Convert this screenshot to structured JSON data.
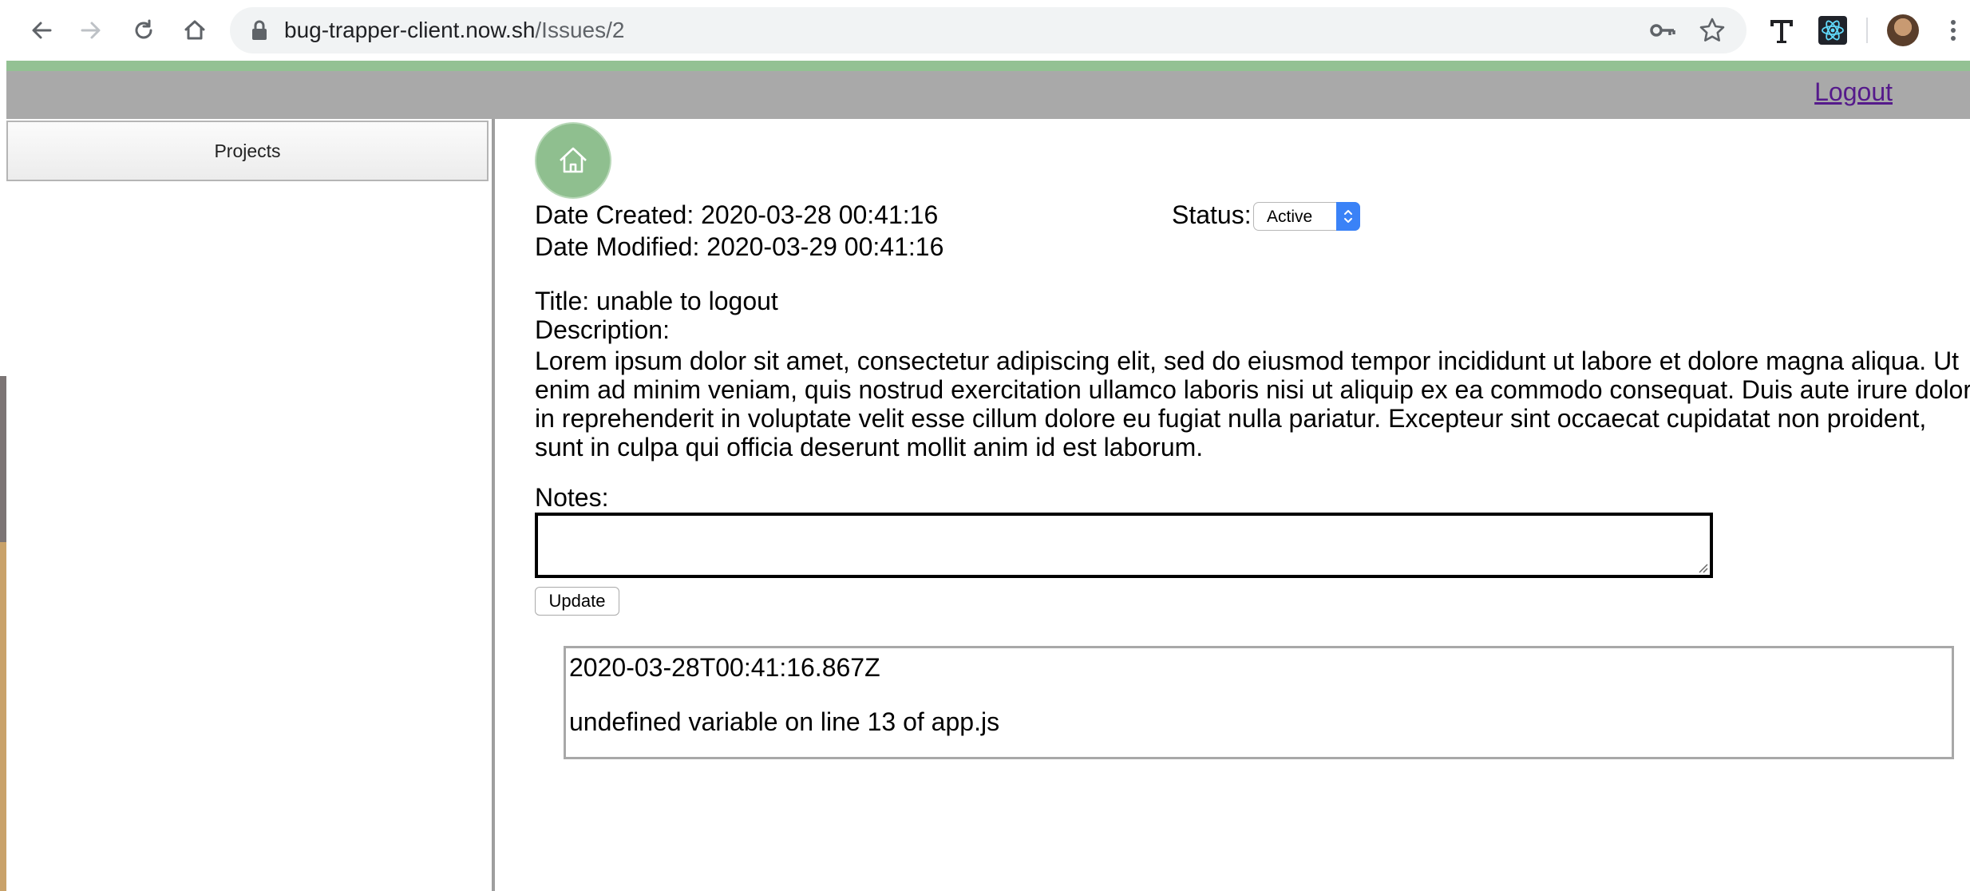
{
  "browser": {
    "url_host": "bug-trapper-client.now.sh",
    "url_path": "/Issues/2"
  },
  "header": {
    "logout_label": "Logout"
  },
  "sidebar": {
    "projects_label": "Projects"
  },
  "issue": {
    "date_created": "Date Created: 2020-03-28 00:41:16",
    "date_modified": "Date Modified: 2020-03-29 00:41:16",
    "status_label": "Status:",
    "status_value": "Active",
    "title": "Title: unable to logout",
    "description_label": "Description:",
    "description": "Lorem ipsum dolor sit amet, consectetur adipiscing elit, sed do eiusmod tempor incididunt ut labore et dolore magna aliqua. Ut enim ad minim veniam, quis nostrud exercitation ullamco laboris nisi ut aliquip ex ea commodo consequat. Duis aute irure dolor in reprehenderit in voluptate velit esse cillum dolore eu fugiat nulla pariatur. Excepteur sint occaecat cupidatat non proident, sunt in culpa qui officia deserunt mollit anim id est laborum.",
    "notes_label": "Notes:",
    "notes_value": "",
    "update_label": "Update"
  },
  "notes": [
    {
      "timestamp": "2020-03-28T00:41:16.867Z",
      "text": "undefined variable on line 13 of app.js"
    }
  ],
  "colors": {
    "accent_bar": "#93c193",
    "header_bg": "#a9a9a9",
    "home_button": "#8fbf8f",
    "select_accent": "#3a82f7"
  }
}
